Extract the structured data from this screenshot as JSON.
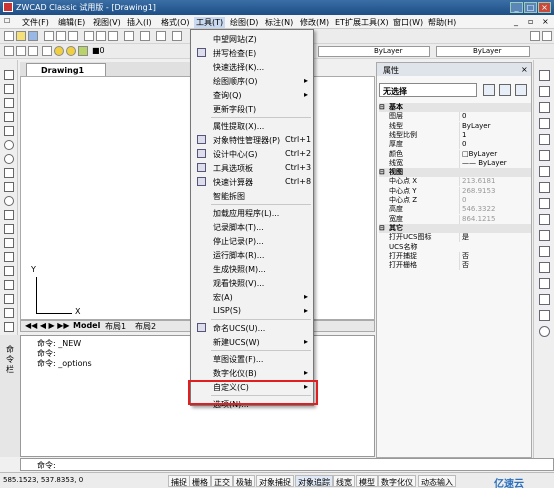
{
  "app": {
    "title": "ZWCAD Classic 试用版 - [Drawing1]",
    "window_controls": [
      "_",
      "□",
      "×"
    ]
  },
  "menubar": {
    "items": [
      "文件(F)",
      "编辑(E)",
      "视图(V)",
      "插入(I)",
      "格式(O)",
      "工具(T)",
      "绘图(D)",
      "标注(N)",
      "修改(M)",
      "ET扩展工具(X)",
      "窗口(W)",
      "帮助(H)"
    ]
  },
  "toolbar": {
    "color_swatch_label": "■0",
    "layer1": "ByLayer",
    "layer2": "ByLayer"
  },
  "drawing": {
    "tab_label": "Drawing1",
    "axis_y": "Y",
    "axis_x": "X"
  },
  "layout_tabs": {
    "model": "Model",
    "layout1": "布局1",
    "layout2": "布局2"
  },
  "tools_menu": [
    {
      "label": "中望网站(Z)",
      "shortcut": "",
      "submenu": false
    },
    {
      "label": "拼写检查(E)",
      "shortcut": "",
      "submenu": false
    },
    {
      "label": "快速选择(K)...",
      "shortcut": "",
      "submenu": false
    },
    {
      "label": "绘图顺序(O)",
      "shortcut": "",
      "submenu": true
    },
    {
      "label": "查询(Q)",
      "shortcut": "",
      "submenu": true
    },
    {
      "label": "更新字段(T)",
      "shortcut": "",
      "submenu": false
    },
    {
      "label": "属性提取(X)...",
      "shortcut": "",
      "submenu": false
    },
    {
      "label": "对象特性管理器(P)",
      "shortcut": "Ctrl+1",
      "submenu": false
    },
    {
      "label": "设计中心(G)",
      "shortcut": "Ctrl+2",
      "submenu": false
    },
    {
      "label": "工具选项板",
      "shortcut": "Ctrl+3",
      "submenu": false
    },
    {
      "label": "快速计算器",
      "shortcut": "Ctrl+8",
      "submenu": false
    },
    {
      "label": "智能拆图",
      "shortcut": "",
      "submenu": false
    },
    {
      "label": "加载应用程序(L)...",
      "shortcut": "",
      "submenu": false
    },
    {
      "label": "记录脚本(T)...",
      "shortcut": "",
      "submenu": false
    },
    {
      "label": "停止记录(P)...",
      "shortcut": "",
      "submenu": false
    },
    {
      "label": "运行脚本(R)...",
      "shortcut": "",
      "submenu": false
    },
    {
      "label": "生成快照(M)...",
      "shortcut": "",
      "submenu": false
    },
    {
      "label": "观看快照(V)...",
      "shortcut": "",
      "submenu": false
    },
    {
      "label": "宏(A)",
      "shortcut": "",
      "submenu": true
    },
    {
      "label": "LISP(S)",
      "shortcut": "",
      "submenu": true
    },
    {
      "label": "命名UCS(U)...",
      "shortcut": "",
      "submenu": false
    },
    {
      "label": "新建UCS(W)",
      "shortcut": "",
      "submenu": true
    },
    {
      "label": "草图设置(F)...",
      "shortcut": "",
      "submenu": false
    },
    {
      "label": "数字化仪(B)",
      "shortcut": "",
      "submenu": true
    },
    {
      "label": "自定义(C)",
      "shortcut": "",
      "submenu": true
    },
    {
      "label": "选项(N)...",
      "shortcut": "",
      "submenu": false
    }
  ],
  "properties": {
    "header": "属性",
    "selection": "无选择",
    "rows": [
      {
        "section": true,
        "key": "基本",
        "value": ""
      },
      {
        "key": "图层",
        "value": "0"
      },
      {
        "key": "线型",
        "value": "ByLayer"
      },
      {
        "key": "线型比例",
        "value": "1"
      },
      {
        "key": "厚度",
        "value": "0"
      },
      {
        "key": "颜色",
        "value": "□ByLayer"
      },
      {
        "key": "线宽",
        "value": "—— ByLayer"
      },
      {
        "section": true,
        "key": "视图",
        "value": ""
      },
      {
        "key": "中心点 X",
        "value": "213.6181",
        "gray": true
      },
      {
        "key": "中心点 Y",
        "value": "268.9153",
        "gray": true
      },
      {
        "key": "中心点 Z",
        "value": "0",
        "gray": true
      },
      {
        "key": "高度",
        "value": "546.3322",
        "gray": true
      },
      {
        "key": "宽度",
        "value": "864.1215",
        "gray": true
      },
      {
        "section": true,
        "key": "其它",
        "value": ""
      },
      {
        "key": "打开UCS图标",
        "value": "是"
      },
      {
        "key": "UCS名称",
        "value": ""
      },
      {
        "key": "打开捕捉",
        "value": "否"
      },
      {
        "key": "打开栅格",
        "value": "否"
      }
    ]
  },
  "command": {
    "side_label": "命令栏",
    "lines": [
      "命令: _NEW",
      "命令:",
      "命令: _options"
    ],
    "prompt": "命令:"
  },
  "status": {
    "coords": "585.1523,  537.8353,  0",
    "toggles": [
      "捕捉",
      "栅格",
      "正交",
      "极轴",
      "对象捕捉",
      "对象追踪",
      "线宽",
      "模型",
      "数字化仪",
      "动态输入"
    ]
  },
  "watermark": "亿速云"
}
